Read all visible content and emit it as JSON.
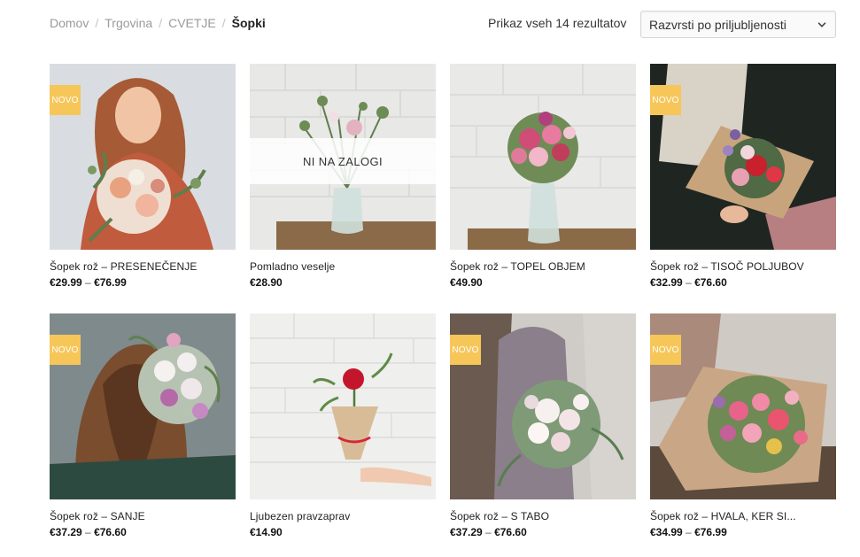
{
  "breadcrumb": {
    "items": [
      "Domov",
      "Trgovina",
      "CVETJE"
    ],
    "separator": "/",
    "current": "Šopki"
  },
  "result_count": "Prikaz vseh 14 rezultatov",
  "sort": {
    "selected": "Razvrsti po priljubljenosti"
  },
  "colors": {
    "badge": "#f6c659",
    "text": "#222222"
  },
  "products": [
    {
      "title": "Šopek rož – PRESENEČENJE",
      "price_from": "€29.99",
      "price_to": "€76.99",
      "badge": "NOVO",
      "stock_label": "",
      "image": "woman-with-bouquet"
    },
    {
      "title": "Pomladno veselje",
      "price_from": "€28.90",
      "price_to": "",
      "badge": "",
      "stock_label": "NI NA ZALOGI",
      "image": "vase-on-table"
    },
    {
      "title": "Šopek rož – TOPEL OBJEM",
      "price_from": "€49.90",
      "price_to": "",
      "badge": "",
      "stock_label": "",
      "image": "vase-pink-roses"
    },
    {
      "title": "Šopek rož – TISOČ POLJUBOV",
      "price_from": "€32.99",
      "price_to": "€76.60",
      "badge": "NOVO",
      "stock_label": "",
      "image": "paper-wrapped-bouquet"
    },
    {
      "title": "Šopek rož – SANJE",
      "price_from": "€37.29",
      "price_to": "€76.60",
      "badge": "NOVO",
      "stock_label": "",
      "image": "woman-back-bouquet"
    },
    {
      "title": "Ljubezen pravzaprav",
      "price_from": "€14.90",
      "price_to": "",
      "badge": "",
      "stock_label": "",
      "image": "single-red-rose"
    },
    {
      "title": "Šopek rož – S TABO",
      "price_from": "€37.29",
      "price_to": "€76.60",
      "badge": "NOVO",
      "stock_label": "",
      "image": "white-rose-bouquet"
    },
    {
      "title": "Šopek rož – HVALA, KER SI...",
      "price_from": "€34.99",
      "price_to": "€76.99",
      "badge": "NOVO",
      "stock_label": "",
      "image": "pink-bouquet-table"
    }
  ]
}
